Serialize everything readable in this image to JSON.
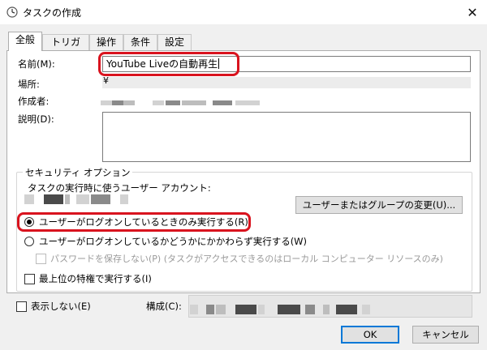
{
  "window": {
    "title": "タスクの作成",
    "close_glyph": "✕"
  },
  "tabs": [
    {
      "label": "全般",
      "active": true
    },
    {
      "label": "トリガー"
    },
    {
      "label": "操作"
    },
    {
      "label": "条件"
    },
    {
      "label": "設定"
    }
  ],
  "general": {
    "name_label": "名前(M):",
    "name_value": "YouTube Liveの自動再生",
    "location_label": "場所:",
    "location_value": "¥",
    "author_label": "作成者:",
    "description_label": "説明(D):"
  },
  "security": {
    "group_title": "セキュリティ オプション",
    "account_label": "タスクの実行時に使うユーザー アカウント:",
    "change_button": "ユーザーまたはグループの変更(U)...",
    "radio_logged_on": "ユーザーがログオンしているときのみ実行する(R)",
    "radio_any": "ユーザーがログオンしているかどうかにかかわらず実行する(W)",
    "no_password": "パスワードを保存しない(P) (タスクがアクセスできるのはローカル コンピューター リソースのみ)",
    "highest_privileges": "最上位の特権で実行する(I)"
  },
  "footer": {
    "hidden_label": "表示しない(E)",
    "config_label": "構成(C):",
    "ok_button": "OK",
    "cancel_button": "キャンセル"
  },
  "colors": {
    "highlight": "#d9131e",
    "focus": "#0078d7"
  },
  "icons": {
    "app": "task-scheduler-icon",
    "close": "close-icon"
  }
}
